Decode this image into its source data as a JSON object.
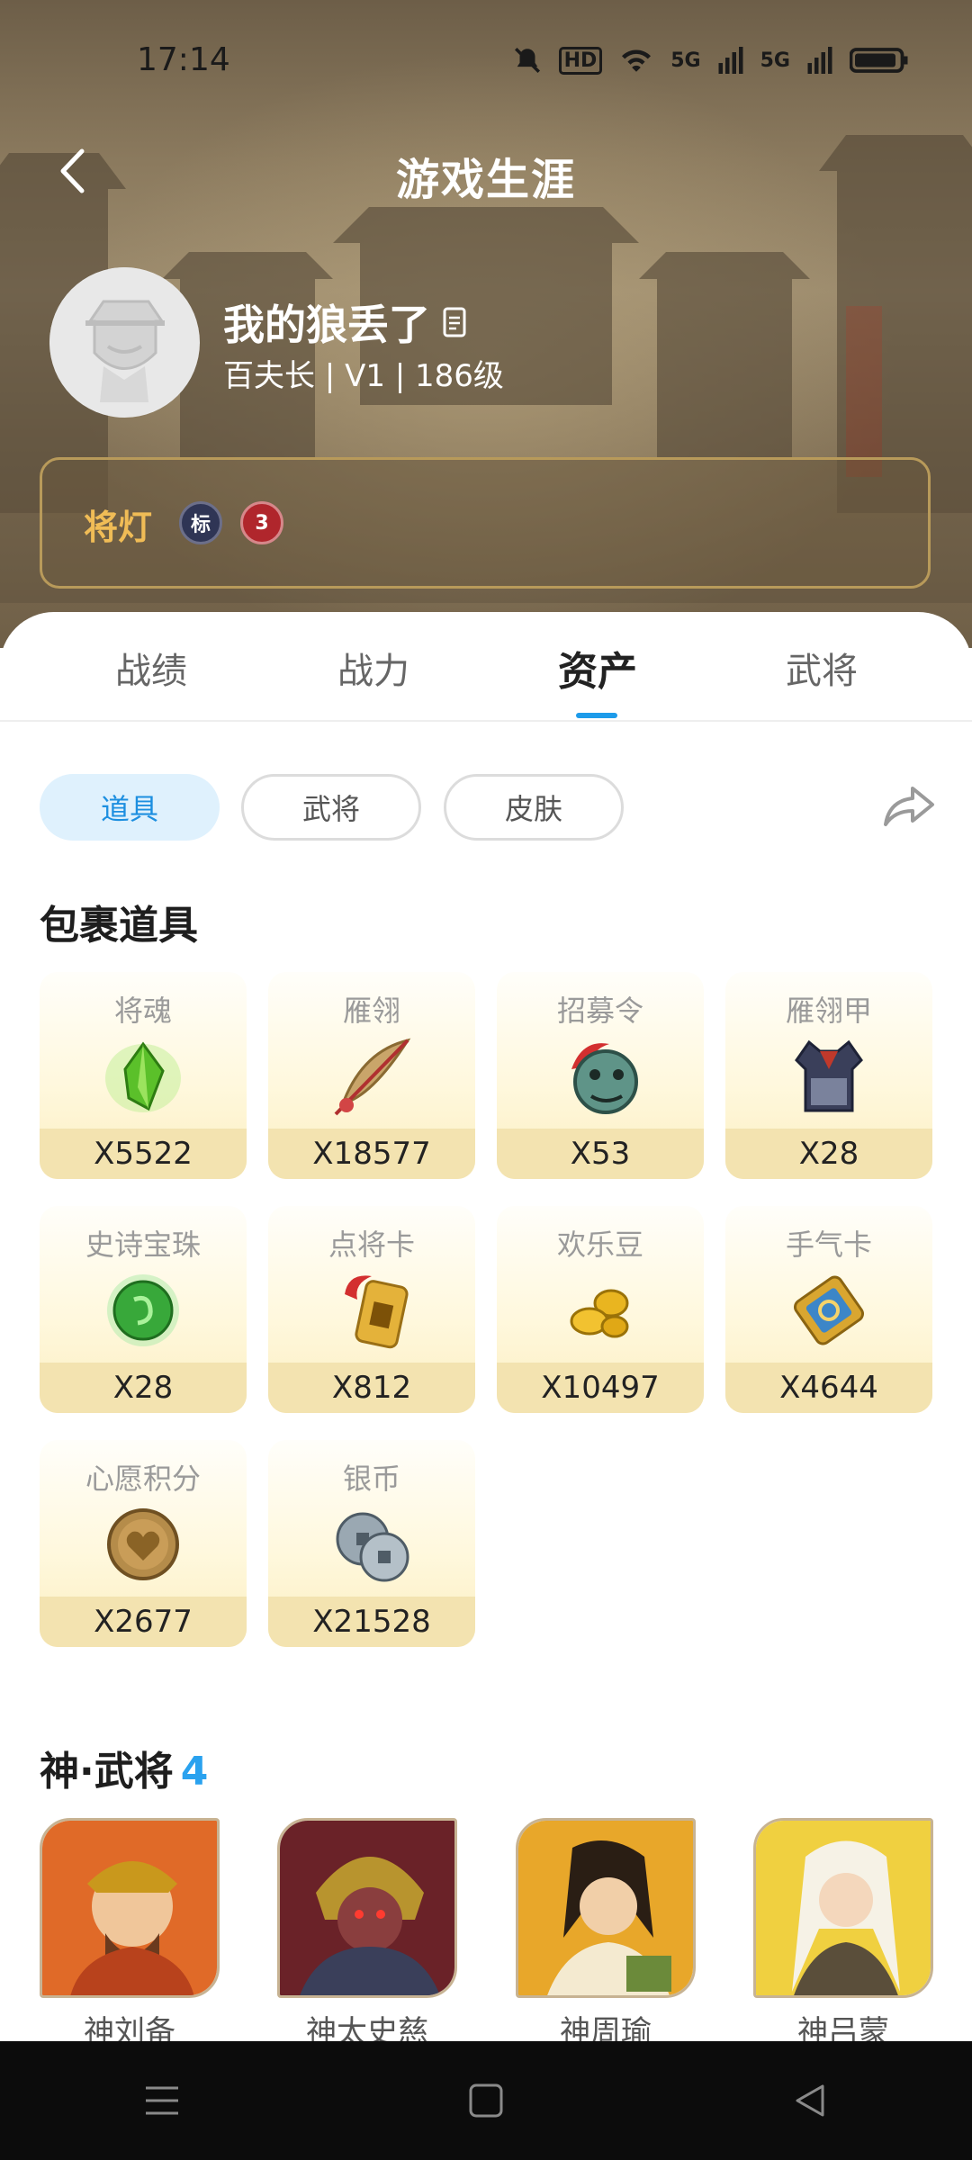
{
  "status_bar": {
    "time": "17:14",
    "hd_label": "HD",
    "net1": "5G",
    "net2": "5G"
  },
  "header": {
    "title": "游戏生涯",
    "nickname": "我的狼丢了",
    "meta": "百夫长 | V1 | 186级",
    "title_name": "将灯",
    "badge_1": "标",
    "badge_2": "3"
  },
  "tabs": [
    "战绩",
    "战力",
    "资产",
    "武将"
  ],
  "active_tab": "资产",
  "filters": [
    "道具",
    "武将",
    "皮肤"
  ],
  "inventory": {
    "title": "包裹道具",
    "items": [
      {
        "name": "将魂",
        "qty": "X5522",
        "icon": "green-crystal-icon"
      },
      {
        "name": "雁翎",
        "qty": "X18577",
        "icon": "feather-icon"
      },
      {
        "name": "招募令",
        "qty": "X53",
        "icon": "mask-token-icon"
      },
      {
        "name": "雁翎甲",
        "qty": "X28",
        "icon": "armor-icon"
      },
      {
        "name": "史诗宝珠",
        "qty": "X28",
        "icon": "green-orb-icon"
      },
      {
        "name": "点将卡",
        "qty": "X812",
        "icon": "general-card-icon"
      },
      {
        "name": "欢乐豆",
        "qty": "X10497",
        "icon": "gold-beans-icon"
      },
      {
        "name": "手气卡",
        "qty": "X4644",
        "icon": "luck-card-icon"
      },
      {
        "name": "心愿积分",
        "qty": "X2677",
        "icon": "heart-coin-icon"
      },
      {
        "name": "银币",
        "qty": "X21528",
        "icon": "silver-coins-icon"
      }
    ]
  },
  "generals": {
    "title": "神·武将",
    "count": "4",
    "list": [
      {
        "name": "神刘备"
      },
      {
        "name": "神太史慈"
      },
      {
        "name": "神周瑜"
      },
      {
        "name": "神吕蒙"
      }
    ]
  },
  "colors": {
    "accent": "#1d9bea",
    "gold": "#f0bc56",
    "item_bg": "#fff8dd"
  }
}
